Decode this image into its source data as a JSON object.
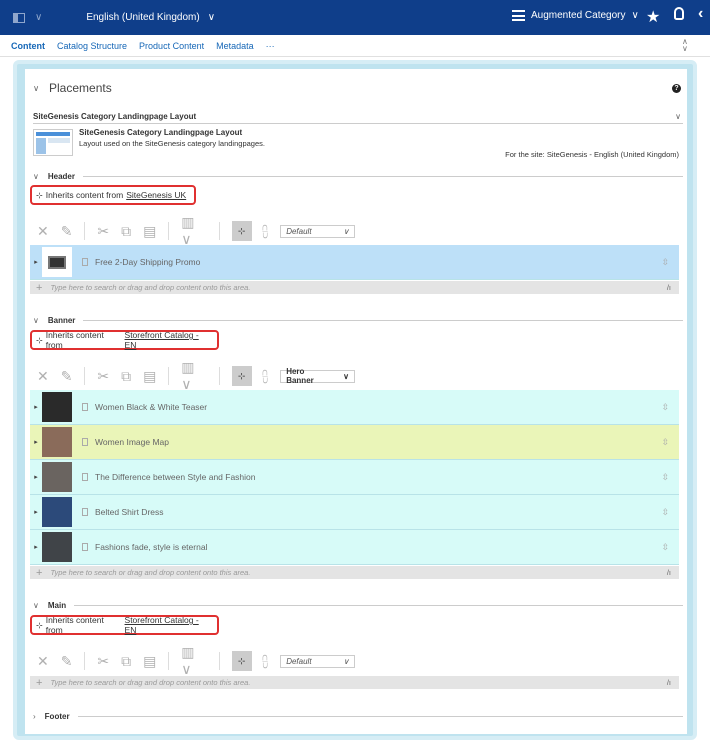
{
  "topbar": {
    "locale": "English (United Kingdom)",
    "mode": "Augmented Category"
  },
  "tabs": [
    "Content",
    "Catalog Structure",
    "Product Content",
    "Metadata",
    "···"
  ],
  "placements": {
    "title": "Placements",
    "layout_title": "SiteGenesis Category Landingpage Layout",
    "layout_name": "SiteGenesis Category Landingpage Layout",
    "layout_desc": "Layout used on the SiteGenesis category landingpages.",
    "site_note": "For the site: SiteGenesis - English (United Kingdom)"
  },
  "inherit_prefix": "Inherits content from",
  "sections": {
    "header": {
      "label": "Header",
      "source": "SiteGenesis UK",
      "view": "Default",
      "items": [
        {
          "label": "Free 2-Day Shipping Promo"
        }
      ]
    },
    "banner": {
      "label": "Banner",
      "source": "Storefront Catalog - EN",
      "view": "Hero Banner",
      "items": [
        {
          "label": "Women Black & White Teaser"
        },
        {
          "label": "Women Image Map"
        },
        {
          "label": "The Difference between Style and Fashion"
        },
        {
          "label": "Belted Shirt Dress"
        },
        {
          "label": "Fashions fade, style is eternal"
        }
      ]
    },
    "main": {
      "label": "Main",
      "source": "Storefront Catalog - EN",
      "view": "Default"
    },
    "footer": {
      "label": "Footer"
    }
  },
  "drop_hint": "Type here to search or drag and drop content onto this area.",
  "colors": {
    "topbar": "#0f3e8a",
    "header_row": "#bde0f8",
    "banner_row": "#d7fbf8",
    "highlight_row": "#eaf5b8",
    "inherit_border": "#e03030"
  }
}
